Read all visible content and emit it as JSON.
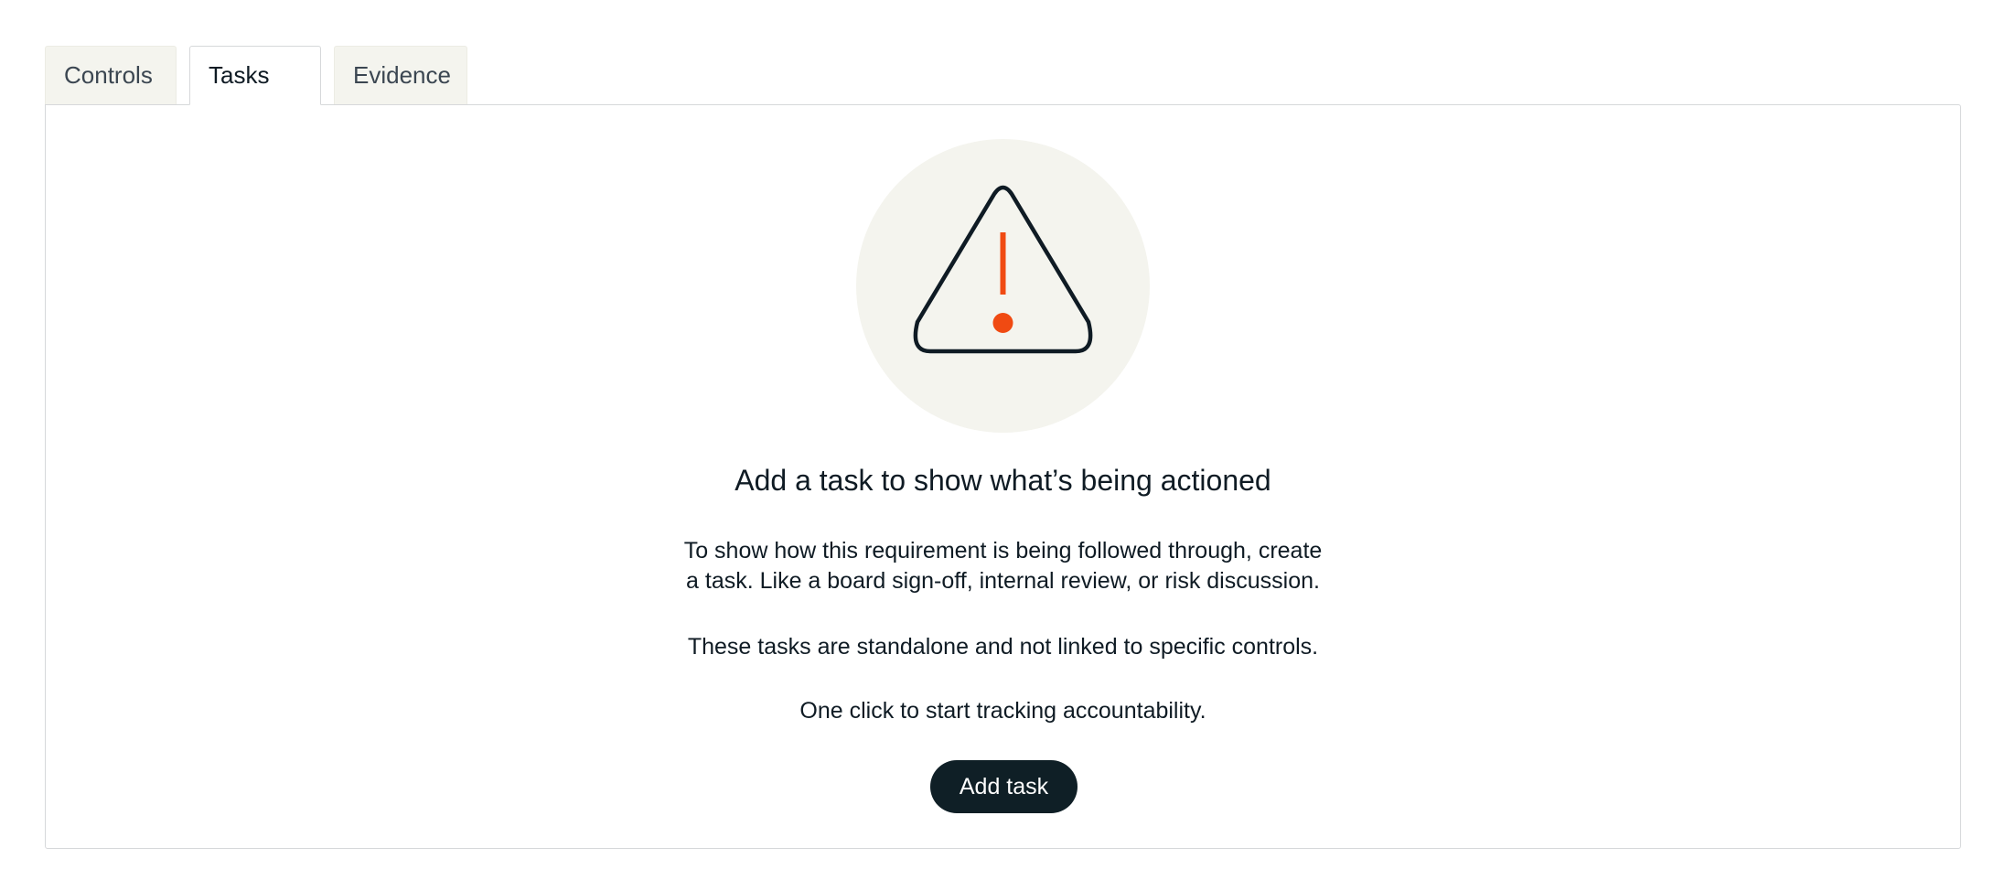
{
  "tabs": [
    {
      "label": "Controls",
      "active": false
    },
    {
      "label": "Tasks",
      "active": true
    },
    {
      "label": "Evidence",
      "active": false
    }
  ],
  "empty_state": {
    "illustration_icon": "warning-triangle-icon",
    "heading": "Add a task to show what’s being actioned",
    "description_line1": "To show how this requirement is being followed through, create",
    "description_line2": "a task. Like a board sign-off, internal review, or risk discussion.",
    "note": "These tasks are standalone and not linked to specific controls.",
    "cta_text": "One click to start tracking accountability.",
    "button_label": "Add task"
  },
  "colors": {
    "accent_orange": "#f04a12",
    "dark": "#0f1f26",
    "illustration_bg": "#f4f4ee",
    "tab_bg": "#f4f4ee",
    "border": "#d6d8da"
  }
}
